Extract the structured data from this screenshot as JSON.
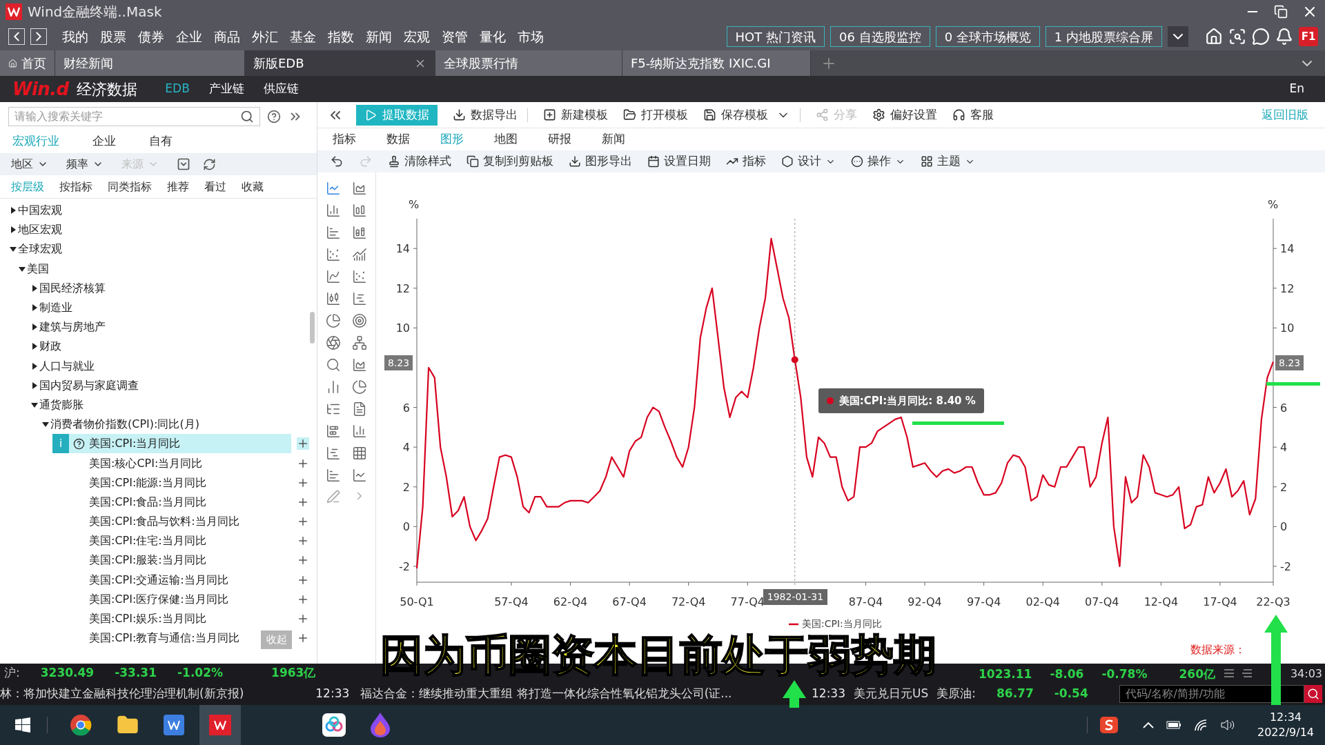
{
  "window": {
    "title": "Wind金融终端..Mask"
  },
  "menu": [
    "我的",
    "股票",
    "债券",
    "企业",
    "商品",
    "外汇",
    "基金",
    "指数",
    "新闻",
    "宏观",
    "资管",
    "量化",
    "市场"
  ],
  "quick_buttons": [
    "HOT 热门资讯",
    "06 自选股监控",
    "0 全球市场概览",
    "1 内地股票综合屏"
  ],
  "help_key": "F1",
  "tabs": [
    {
      "label": "首页",
      "kind": "home",
      "selected": false
    },
    {
      "label": "财经新闻",
      "kind": "page",
      "selected": false
    },
    {
      "label": "新版EDB",
      "kind": "page",
      "selected": true
    },
    {
      "label": "全球股票行情",
      "kind": "page",
      "selected": false
    },
    {
      "label": "F5-纳斯达克指数 IXIC.GI",
      "kind": "page",
      "selected": false
    }
  ],
  "app_header": {
    "logo": "Win.d",
    "title": "经济数据",
    "nav": [
      {
        "label": "EDB",
        "selected": true
      },
      {
        "label": "产业链",
        "selected": false
      },
      {
        "label": "供应链",
        "selected": false
      }
    ],
    "language": "En"
  },
  "left_panel": {
    "search": {
      "placeholder": "请输入搜索关键字"
    },
    "categories": [
      {
        "label": "宏观行业",
        "selected": true
      },
      {
        "label": "企业",
        "selected": false
      },
      {
        "label": "自有",
        "selected": false
      }
    ],
    "filters": [
      {
        "label": "地区",
        "disabled": false
      },
      {
        "label": "频率",
        "disabled": false
      },
      {
        "label": "来源",
        "disabled": true
      }
    ],
    "views": [
      {
        "label": "按层级",
        "selected": true
      },
      {
        "label": "按指标",
        "selected": false
      },
      {
        "label": "同类指标",
        "selected": false
      },
      {
        "label": "推荐",
        "selected": false
      },
      {
        "label": "看过",
        "selected": false
      },
      {
        "label": "收藏",
        "selected": false
      }
    ],
    "selection_badge": "i",
    "tree": [
      {
        "label": "中国宏观",
        "kind": "folder",
        "expanded": false
      },
      {
        "label": "地区宏观",
        "kind": "folder",
        "expanded": false
      },
      {
        "label": "全球宏观",
        "kind": "folder",
        "expanded": true,
        "children": [
          {
            "label": "美国",
            "kind": "folder",
            "expanded": true,
            "children": [
              {
                "label": "国民经济核算",
                "kind": "folder",
                "expanded": false
              },
              {
                "label": "制造业",
                "kind": "folder",
                "expanded": false
              },
              {
                "label": "建筑与房地产",
                "kind": "folder",
                "expanded": false
              },
              {
                "label": "财政",
                "kind": "folder",
                "expanded": false
              },
              {
                "label": "人口与就业",
                "kind": "folder",
                "expanded": false
              },
              {
                "label": "国内贸易与家庭调查",
                "kind": "folder",
                "expanded": false
              },
              {
                "label": "通货膨胀",
                "kind": "folder",
                "expanded": true,
                "children": [
                  {
                    "label": "消费者物价指数(CPI):同比(月)",
                    "kind": "folder",
                    "expanded": true,
                    "children": [
                      {
                        "label": "美国:CPI:当月同比",
                        "kind": "indicator",
                        "selected": true
                      },
                      {
                        "label": "美国:核心CPI:当月同比",
                        "kind": "indicator",
                        "selected": false
                      },
                      {
                        "label": "美国:CPI:能源:当月同比",
                        "kind": "indicator",
                        "selected": false
                      },
                      {
                        "label": "美国:CPI:食品:当月同比",
                        "kind": "indicator",
                        "selected": false
                      },
                      {
                        "label": "美国:CPI:食品与饮料:当月同比",
                        "kind": "indicator",
                        "selected": false
                      },
                      {
                        "label": "美国:CPI:住宅:当月同比",
                        "kind": "indicator",
                        "selected": false
                      },
                      {
                        "label": "美国:CPI:服装:当月同比",
                        "kind": "indicator",
                        "selected": false
                      },
                      {
                        "label": "美国:CPI:交通运输:当月同比",
                        "kind": "indicator",
                        "selected": false
                      },
                      {
                        "label": "美国:CPI:医疗保健:当月同比",
                        "kind": "indicator",
                        "selected": false
                      },
                      {
                        "label": "美国:CPI:娱乐:当月同比",
                        "kind": "indicator",
                        "selected": false
                      },
                      {
                        "label": "美国:CPI:教育与通信:当月同比",
                        "kind": "indicator",
                        "selected": false
                      }
                    ]
                  }
                ]
              }
            ]
          }
        ]
      }
    ],
    "collapse_button": "收起"
  },
  "toolbar": {
    "primary": "提取数据",
    "actions": [
      {
        "label": "数据导出",
        "kind": "export",
        "disabled": false
      },
      {
        "label": "新建模板",
        "kind": "new",
        "disabled": false
      },
      {
        "label": "打开模板",
        "kind": "open",
        "disabled": false
      },
      {
        "label": "保存模板",
        "kind": "save",
        "disabled": false
      },
      {
        "label": "分享",
        "kind": "share",
        "disabled": true
      },
      {
        "label": "偏好设置",
        "kind": "settings",
        "disabled": false
      },
      {
        "label": "客服",
        "kind": "support",
        "disabled": false
      }
    ],
    "back_link": "返回旧版"
  },
  "view_tabs": [
    {
      "label": "指标",
      "selected": false
    },
    {
      "label": "数据",
      "selected": false
    },
    {
      "label": "图形",
      "selected": true
    },
    {
      "label": "地图",
      "selected": false
    },
    {
      "label": "研报",
      "selected": false
    },
    {
      "label": "新闻",
      "selected": false
    }
  ],
  "chart_toolbar": {
    "redo_disabled": true,
    "items": [
      {
        "label": "清除样式",
        "kind": "clear",
        "dropdown": false
      },
      {
        "label": "复制到剪贴板",
        "kind": "copy",
        "dropdown": false
      },
      {
        "label": "图形导出",
        "kind": "export",
        "dropdown": false
      },
      {
        "label": "设置日期",
        "kind": "date",
        "dropdown": false
      },
      {
        "label": "指标",
        "kind": "indicator",
        "dropdown": false
      },
      {
        "label": "设计",
        "kind": "design",
        "dropdown": true
      },
      {
        "label": "操作",
        "kind": "action",
        "dropdown": true
      },
      {
        "label": "主题",
        "kind": "theme",
        "dropdown": true
      }
    ]
  },
  "chart_types": [
    {
      "selected": true
    },
    {
      "selected": false
    },
    {
      "selected": false
    },
    {
      "selected": false
    },
    {
      "selected": false
    },
    {
      "selected": false
    },
    {
      "selected": false
    },
    {
      "selected": false
    },
    {
      "selected": false
    },
    {
      "selected": false
    },
    {
      "selected": false
    },
    {
      "selected": false
    },
    {
      "selected": false
    },
    {
      "selected": false
    },
    {
      "selected": false
    },
    {
      "selected": false
    },
    {
      "selected": false
    },
    {
      "selected": false
    },
    {
      "selected": false
    },
    {
      "selected": false
    },
    {
      "selected": false
    },
    {
      "selected": false
    },
    {
      "selected": false
    },
    {
      "selected": false
    },
    {
      "selected": false
    },
    {
      "selected": false
    },
    {
      "selected": false
    },
    {
      "selected": false
    }
  ],
  "chart": {
    "unit_left": "%",
    "unit_right": "%",
    "right_yticks": [
      "14",
      "12",
      "10",
      "6",
      "4",
      "2",
      "0",
      "-2"
    ],
    "source": "数据来源：",
    "cursor": {
      "date": "1982-01-31",
      "left_value": "8.23",
      "right_value": "8.23",
      "tooltip": "美国:CPI:当月同比: 8.40 %"
    },
    "chart_data": {
      "type": "line",
      "ylim": [
        -2.8,
        15.5
      ],
      "yticks": [
        {
          "value": 14,
          "label": "14"
        },
        {
          "value": 12,
          "label": "12"
        },
        {
          "value": 10,
          "label": "10"
        },
        {
          "value": 6,
          "label": "6"
        },
        {
          "value": 4,
          "label": "4"
        },
        {
          "value": 2,
          "label": "2"
        },
        {
          "value": 0,
          "label": "0"
        },
        {
          "value": -2,
          "label": "-2"
        }
      ],
      "categories": [
        "50-Q1",
        null,
        null,
        null,
        null,
        null,
        null,
        null,
        null,
        null,
        null,
        null,
        null,
        null,
        null,
        null,
        "57-Q4",
        null,
        null,
        null,
        null,
        null,
        null,
        null,
        null,
        null,
        "62-Q4",
        null,
        null,
        null,
        null,
        null,
        null,
        null,
        null,
        null,
        "67-Q4",
        null,
        null,
        null,
        null,
        null,
        null,
        null,
        null,
        null,
        "72-Q4",
        null,
        null,
        null,
        null,
        null,
        null,
        null,
        null,
        null,
        "77-Q4",
        null,
        null,
        null,
        null,
        null,
        null,
        null,
        null,
        null,
        null,
        null,
        null,
        null,
        null,
        null,
        null,
        null,
        null,
        null,
        "87-Q4",
        null,
        null,
        null,
        null,
        null,
        null,
        null,
        null,
        null,
        "92-Q4",
        null,
        null,
        null,
        null,
        null,
        null,
        null,
        null,
        null,
        "97-Q4",
        null,
        null,
        null,
        null,
        null,
        null,
        null,
        null,
        null,
        "02-Q4",
        null,
        null,
        null,
        null,
        null,
        null,
        null,
        null,
        null,
        "07-Q4",
        null,
        null,
        null,
        null,
        null,
        null,
        null,
        null,
        null,
        "12-Q4",
        null,
        null,
        null,
        null,
        null,
        null,
        null,
        null,
        null,
        "17-Q4",
        null,
        null,
        null,
        null,
        null,
        null,
        null,
        null,
        "22-Q3"
      ],
      "series": [
        {
          "name": "美国:CPI:当月同比",
          "color": "#d7001f",
          "values": [
            -2.1,
            1.0,
            8.0,
            7.5,
            4.0,
            2.5,
            0.5,
            0.8,
            1.5,
            0.0,
            -0.7,
            -0.2,
            0.4,
            2.0,
            3.5,
            3.6,
            3.5,
            2.5,
            1.0,
            0.7,
            1.5,
            1.5,
            1.0,
            1.0,
            1.0,
            1.2,
            1.3,
            1.3,
            1.3,
            1.2,
            1.5,
            1.8,
            2.5,
            3.5,
            3.0,
            2.5,
            3.8,
            4.3,
            4.5,
            5.5,
            6.0,
            5.8,
            5.0,
            4.3,
            3.5,
            3.0,
            4.0,
            6.0,
            9.5,
            11.0,
            12.0,
            9.5,
            7.0,
            5.5,
            6.5,
            6.8,
            6.5,
            8.0,
            10.0,
            11.5,
            14.5,
            13.0,
            11.5,
            10.5,
            8.4,
            6.5,
            3.5,
            2.5,
            4.5,
            4.2,
            3.5,
            3.5,
            2.0,
            1.3,
            1.5,
            4.0,
            4.0,
            4.2,
            4.8,
            5.0,
            5.2,
            5.4,
            5.5,
            4.5,
            3.0,
            3.1,
            3.2,
            2.8,
            2.5,
            2.8,
            2.9,
            2.7,
            2.8,
            3.0,
            3.0,
            2.2,
            1.6,
            1.6,
            1.7,
            2.2,
            3.2,
            3.6,
            3.5,
            3.0,
            1.3,
            1.5,
            2.6,
            2.1,
            2.0,
            3.0,
            3.0,
            3.5,
            4.0,
            4.0,
            2.0,
            2.5,
            4.2,
            5.5,
            0.0,
            -2.0,
            2.5,
            1.2,
            1.5,
            3.6,
            3.0,
            1.7,
            1.6,
            1.5,
            1.6,
            2.0,
            -0.1,
            0.1,
            1.0,
            1.1,
            2.5,
            1.7,
            2.2,
            2.9,
            1.5,
            1.8,
            2.3,
            0.6,
            1.4,
            5.4,
            7.5,
            8.3
          ]
        }
      ]
    }
  },
  "caption": "因为币圈资本目前处于弱势期",
  "status_left": [
    {
      "text": "沪:",
      "kind": "label"
    },
    {
      "text": "3230.49",
      "kind": "value"
    },
    {
      "text": "-33.31",
      "kind": "value"
    },
    {
      "text": "-1.02%",
      "kind": "value"
    },
    {
      "text": "1963亿",
      "kind": "value"
    }
  ],
  "status_right": [
    {
      "text": "1023.11",
      "kind": "value"
    },
    {
      "text": "-8.06",
      "kind": "value"
    },
    {
      "text": "-0.78%",
      "kind": "value"
    },
    {
      "text": "260亿",
      "kind": "value"
    }
  ],
  "status_clock": "34:03",
  "ticker_left": [
    {
      "text": "林：将加快建立金融科技伦理治理机制(新京报)",
      "kind": "news"
    },
    {
      "text": "12:33",
      "kind": "time"
    },
    {
      "text": "福达合金：继续推动重大重组 将打造一体化综合性氧化铝龙头公司(证...",
      "kind": "news"
    }
  ],
  "ticker_right": [
    {
      "text": "12:33",
      "kind": "time"
    },
    {
      "text": "美元兑日元US",
      "kind": "news"
    },
    {
      "text": "美原油:",
      "kind": "news"
    },
    {
      "text": "86.77",
      "kind": "value"
    },
    {
      "text": "-0.54",
      "kind": "value"
    }
  ],
  "command_search": {
    "placeholder": "代码/名称/简拼/功能"
  },
  "taskbar": {
    "time": "12:34",
    "date": "2022/9/14"
  }
}
